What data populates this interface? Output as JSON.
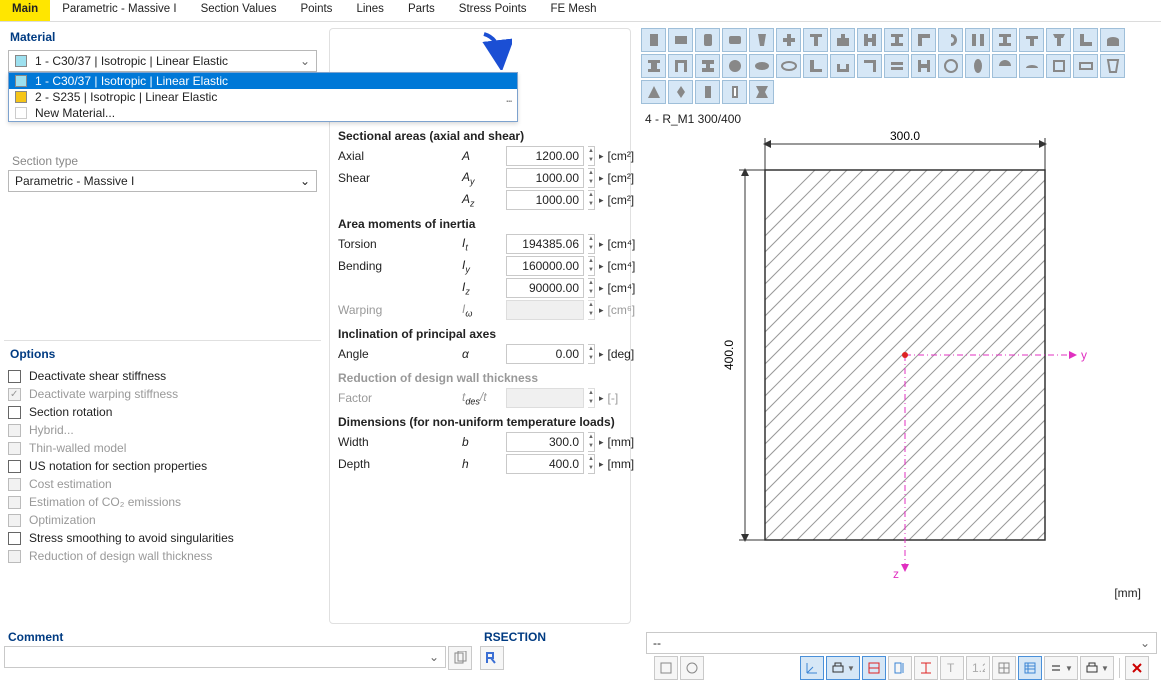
{
  "tabs": [
    "Main",
    "Parametric - Massive I",
    "Section Values",
    "Points",
    "Lines",
    "Parts",
    "Stress Points",
    "FE Mesh"
  ],
  "activeTab": 0,
  "materialPanel": {
    "title": "Material",
    "selected": "1 - C30/37 | Isotropic | Linear Elastic",
    "options": [
      {
        "swatch": "#9de0ef",
        "label": "1 - C30/37 | Isotropic | Linear Elastic",
        "sel": true
      },
      {
        "swatch": "#f5c518",
        "label": "2 - S235 | Isotropic | Linear Elastic",
        "sel": false,
        "more": true
      },
      {
        "swatch": "transparent",
        "label": "New Material...",
        "sel": false
      }
    ]
  },
  "extraBtns": [
    "library-icon",
    "new-icon",
    "edit-icon",
    "delete-icon"
  ],
  "sectionType": {
    "label": "Section type",
    "value": "Parametric - Massive I"
  },
  "options": {
    "title": "Options",
    "items": [
      {
        "label": "Deactivate shear stiffness",
        "checked": false,
        "disabled": false
      },
      {
        "label": "Deactivate warping stiffness",
        "checked": true,
        "disabled": true
      },
      {
        "label": "Section rotation",
        "checked": false,
        "disabled": false
      },
      {
        "label": "Hybrid...",
        "checked": false,
        "disabled": true
      },
      {
        "label": "Thin-walled model",
        "checked": false,
        "disabled": true
      },
      {
        "label": "US notation for section properties",
        "checked": false,
        "disabled": false
      },
      {
        "label": "Cost estimation",
        "checked": false,
        "disabled": true
      },
      {
        "label": "Estimation of CO₂ emissions",
        "checked": false,
        "disabled": true
      },
      {
        "label": "Optimization",
        "checked": false,
        "disabled": true
      },
      {
        "label": "Stress smoothing to avoid singularities",
        "checked": false,
        "disabled": false
      },
      {
        "label": "Reduction of design wall thickness",
        "checked": false,
        "disabled": true
      }
    ]
  },
  "props": {
    "groups": [
      {
        "title": "Sectional areas (axial and shear)",
        "rows": [
          {
            "lbl": "Axial",
            "sym": "A",
            "val": "1200.00",
            "unit": "[cm²]"
          },
          {
            "lbl": "Shear",
            "sym": "A<sub>y</sub>",
            "val": "1000.00",
            "unit": "[cm²]"
          },
          {
            "lbl": "",
            "sym": "A<sub>z</sub>",
            "val": "1000.00",
            "unit": "[cm²]"
          }
        ]
      },
      {
        "title": "Area moments of inertia",
        "rows": [
          {
            "lbl": "Torsion",
            "sym": "I<sub>t</sub>",
            "val": "194385.06",
            "unit": "[cm⁴]"
          },
          {
            "lbl": "Bending",
            "sym": "I<sub>y</sub>",
            "val": "160000.00",
            "unit": "[cm⁴]"
          },
          {
            "lbl": "",
            "sym": "I<sub>z</sub>",
            "val": "90000.00",
            "unit": "[cm⁴]"
          },
          {
            "lbl": "Warping",
            "sym": "I<sub>ω</sub>",
            "val": "",
            "unit": "[cm⁶]",
            "dis": true
          }
        ]
      },
      {
        "title": "Inclination of principal axes",
        "rows": [
          {
            "lbl": "Angle",
            "sym": "α",
            "val": "0.00",
            "unit": "[deg]"
          }
        ]
      },
      {
        "title": "Reduction of design wall thickness",
        "dis": true,
        "rows": [
          {
            "lbl": "Factor",
            "sym": "t<sub>des</sub>/t",
            "val": "",
            "unit": "[-]",
            "dis": true
          }
        ]
      },
      {
        "title": "Dimensions (for non-uniform temperature loads)",
        "rows": [
          {
            "lbl": "Width",
            "sym": "b",
            "val": "300.0",
            "unit": "[mm]"
          },
          {
            "lbl": "Depth",
            "sym": "h",
            "val": "400.0",
            "unit": "[mm]"
          }
        ]
      }
    ]
  },
  "viewer": {
    "title": "4 - R_M1 300/400",
    "width": "300.0",
    "height": "400.0",
    "unit": "[mm]",
    "yAxis": "y",
    "zAxis": "z"
  },
  "commentPanel": {
    "title": "Comment",
    "value": ""
  },
  "rsectionPanel": {
    "title": "RSECTION"
  },
  "rightDD": "--"
}
